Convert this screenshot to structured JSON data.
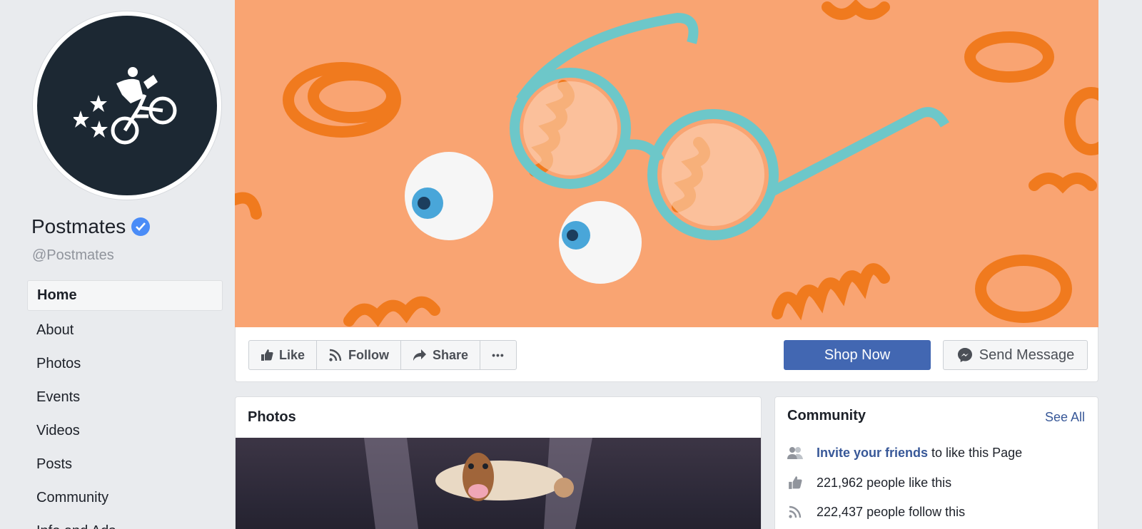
{
  "profile": {
    "name": "Postmates",
    "handle": "@Postmates"
  },
  "nav": {
    "items": [
      {
        "label": "Home",
        "active": true
      },
      {
        "label": "About"
      },
      {
        "label": "Photos"
      },
      {
        "label": "Events"
      },
      {
        "label": "Videos"
      },
      {
        "label": "Posts"
      },
      {
        "label": "Community"
      },
      {
        "label": "Info and Ads"
      }
    ]
  },
  "actions": {
    "like": "Like",
    "follow": "Follow",
    "share": "Share",
    "more": "•••",
    "shop_now": "Shop Now",
    "send_message": "Send Message"
  },
  "photos": {
    "title": "Photos"
  },
  "community": {
    "title": "Community",
    "see_all": "See All",
    "invite_link": "Invite your friends",
    "invite_rest": " to like this Page",
    "likes": "221,962 people like this",
    "follows": "222,437 people follow this"
  },
  "colors": {
    "brand_blue": "#4267b2",
    "link_blue": "#385898",
    "cover_orange": "#f9a472",
    "avatar_dark": "#1c2833",
    "verified_blue": "#4a8cf7"
  }
}
